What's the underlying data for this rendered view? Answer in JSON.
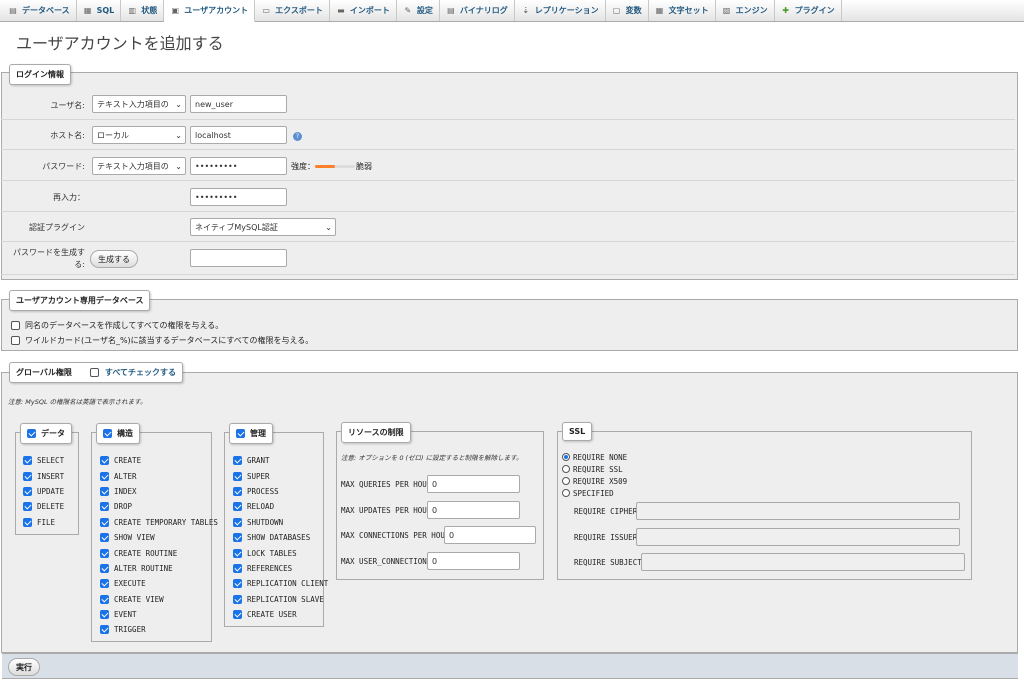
{
  "tabs": [
    {
      "label": "データベース",
      "icon": "database-icon"
    },
    {
      "label": "SQL",
      "icon": "sql-icon"
    },
    {
      "label": "状態",
      "icon": "status-icon"
    },
    {
      "label": "ユーザアカウント",
      "icon": "users-icon",
      "active": true
    },
    {
      "label": "エクスポート",
      "icon": "export-icon"
    },
    {
      "label": "インポート",
      "icon": "import-icon"
    },
    {
      "label": "設定",
      "icon": "wrench-icon"
    },
    {
      "label": "バイナリログ",
      "icon": "binlog-icon"
    },
    {
      "label": "レプリケーション",
      "icon": "replication-icon"
    },
    {
      "label": "変数",
      "icon": "variables-icon"
    },
    {
      "label": "文字セット",
      "icon": "charset-icon"
    },
    {
      "label": "エンジン",
      "icon": "engine-icon"
    },
    {
      "label": "プラグイン",
      "icon": "plugin-icon"
    }
  ],
  "page_title": "ユーザアカウントを追加する",
  "login": {
    "legend": "ログイン情報",
    "username_label": "ユーザ名:",
    "username_mode": "テキスト入力項目の",
    "username_value": "new_user",
    "host_label": "ホスト名:",
    "host_mode": "ローカル",
    "host_value": "localhost",
    "password_label": "パスワード:",
    "password_mode": "テキスト入力項目の",
    "password_value": "•••••••••",
    "strength_label": "強度：",
    "strength_value": "脆弱",
    "reenter_label": "再入力：",
    "reenter_value": "•••••••••",
    "auth_label": "認証プラグイン",
    "auth_value": "ネイティブMySQL認証",
    "generate_label": "パスワードを生成する:",
    "generate_button": "生成する",
    "generated_value": ""
  },
  "userdb": {
    "legend": "ユーザアカウント専用データベース",
    "option1": "同名のデータベースを作成してすべての権限を与える。",
    "option2": "ワイルドカード(ユーザ名_%)に該当するデータベースにすべての権限を与える。"
  },
  "global": {
    "legend": "グローバル権限",
    "check_all": "すべてチェックする",
    "note": "注意: MySQL の権限名は英語で表示されます。",
    "data": {
      "legend": "データ",
      "items": [
        "SELECT",
        "INSERT",
        "UPDATE",
        "DELETE",
        "FILE"
      ]
    },
    "structure": {
      "legend": "構造",
      "items": [
        "CREATE",
        "ALTER",
        "INDEX",
        "DROP",
        "CREATE TEMPORARY TABLES",
        "SHOW VIEW",
        "CREATE ROUTINE",
        "ALTER ROUTINE",
        "EXECUTE",
        "CREATE VIEW",
        "EVENT",
        "TRIGGER"
      ]
    },
    "admin": {
      "legend": "管理",
      "items": [
        "GRANT",
        "SUPER",
        "PROCESS",
        "RELOAD",
        "SHUTDOWN",
        "SHOW DATABASES",
        "LOCK TABLES",
        "REFERENCES",
        "REPLICATION CLIENT",
        "REPLICATION SLAVE",
        "CREATE USER"
      ]
    },
    "resources": {
      "legend": "リソースの制限",
      "note": "注意: オプションを 0 (ゼロ) に設定すると制限を解除します。",
      "items": [
        {
          "label": "MAX QUERIES PER HOUR",
          "value": "0"
        },
        {
          "label": "MAX UPDATES PER HOUR",
          "value": "0"
        },
        {
          "label": "MAX CONNECTIONS PER HOUR",
          "value": "0"
        },
        {
          "label": "MAX USER_CONNECTIONS",
          "value": "0"
        }
      ]
    },
    "ssl": {
      "legend": "SSL",
      "options": [
        "REQUIRE NONE",
        "REQUIRE SSL",
        "REQUIRE X509",
        "SPECIFIED"
      ],
      "selected": "REQUIRE NONE",
      "fields": [
        "REQUIRE CIPHER",
        "REQUIRE ISSUER",
        "REQUIRE SUBJECT"
      ]
    }
  },
  "footer": {
    "submit": "実行"
  },
  "colors": {
    "link": "#235a81",
    "checkbox": "#1a73e8",
    "footer": "#d8dfe6",
    "strength_bar": "#ff7f2a"
  }
}
